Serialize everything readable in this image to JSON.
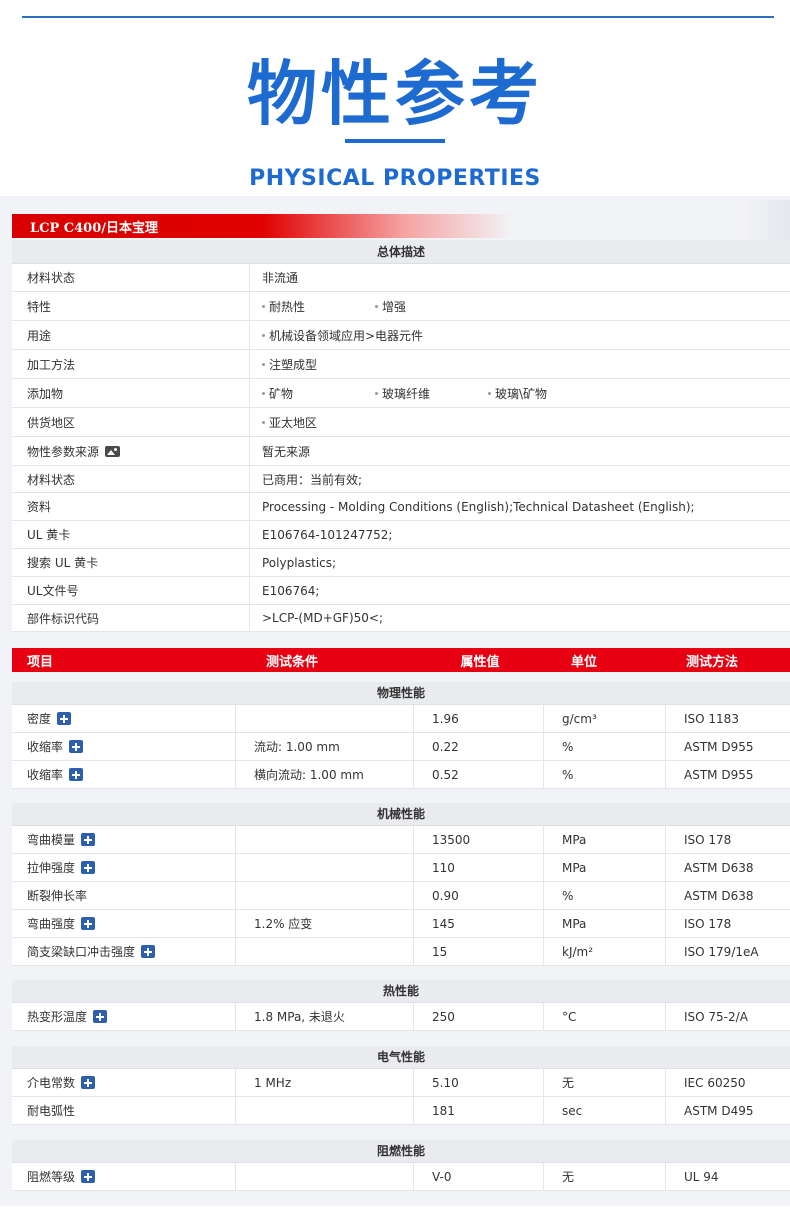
{
  "header": {
    "title": "物性参考",
    "subtitle": "PHYSICAL PROPERTIES"
  },
  "grade": {
    "title": "LCP C400/日本宝理"
  },
  "general": {
    "section_title": "总体描述",
    "rows": [
      {
        "label": "材料状态",
        "values": [
          "非流通"
        ],
        "bullets": false
      },
      {
        "label": "特性",
        "values": [
          "耐热性",
          "增强"
        ],
        "bullets": true
      },
      {
        "label": "用途",
        "values": [
          "机械设备领域应用>电器元件"
        ],
        "bullets": true
      },
      {
        "label": "加工方法",
        "values": [
          "注塑成型"
        ],
        "bullets": true
      },
      {
        "label": "添加物",
        "values": [
          "矿物",
          "玻璃纤维",
          "玻璃\\矿物"
        ],
        "bullets": true
      },
      {
        "label": "供货地区",
        "values": [
          "亚太地区"
        ],
        "bullets": true
      },
      {
        "label": "物性参数来源",
        "values": [
          "暂无来源"
        ],
        "bullets": false,
        "icon": "image-icon"
      },
      {
        "label": "材料状态",
        "values": [
          "已商用：当前有效;"
        ],
        "bullets": false
      },
      {
        "label": "资料",
        "values": [
          "Processing - Molding Conditions (English);Technical Datasheet (English);"
        ],
        "bullets": false
      },
      {
        "label": "UL 黄卡",
        "values": [
          "E106764-101247752;"
        ],
        "bullets": false
      },
      {
        "label": "搜索 UL 黄卡",
        "values": [
          "Polyplastics;"
        ],
        "bullets": false
      },
      {
        "label": "UL文件号",
        "values": [
          "E106764;"
        ],
        "bullets": false
      },
      {
        "label": "部件标识代码",
        "values": [
          ">LCP-(MD+GF)50<;"
        ],
        "bullets": false
      }
    ]
  },
  "table_header": {
    "item": "项目",
    "condition": "测试条件",
    "value": "属性值",
    "unit": "单位",
    "method": "测试方法"
  },
  "categories": [
    {
      "title": "物理性能",
      "rows": [
        {
          "name": "密度",
          "plus": true,
          "condition": "",
          "value": "1.96",
          "unit": "g/cm³",
          "method": "ISO 1183"
        },
        {
          "name": "收缩率",
          "plus": true,
          "condition": "流动: 1.00 mm",
          "value": "0.22",
          "unit": "%",
          "method": "ASTM D955"
        },
        {
          "name": "收缩率",
          "plus": true,
          "condition": "横向流动: 1.00 mm",
          "value": "0.52",
          "unit": "%",
          "method": "ASTM D955"
        }
      ]
    },
    {
      "title": "机械性能",
      "rows": [
        {
          "name": "弯曲模量",
          "plus": true,
          "condition": "",
          "value": "13500",
          "unit": "MPa",
          "method": "ISO 178"
        },
        {
          "name": "拉伸强度",
          "plus": true,
          "condition": "",
          "value": "110",
          "unit": "MPa",
          "method": "ASTM D638"
        },
        {
          "name": "断裂伸长率",
          "plus": false,
          "condition": "",
          "value": "0.90",
          "unit": "%",
          "method": "ASTM D638"
        },
        {
          "name": "弯曲强度",
          "plus": true,
          "condition": "1.2% 应变",
          "value": "145",
          "unit": "MPa",
          "method": "ISO 178"
        },
        {
          "name": "简支梁缺口冲击强度",
          "plus": true,
          "condition": "",
          "value": "15",
          "unit": "kJ/m²",
          "method": "ISO 179/1eA"
        }
      ]
    },
    {
      "title": "热性能",
      "rows": [
        {
          "name": "热变形温度",
          "plus": true,
          "condition": "1.8 MPa, 未退火",
          "value": "250",
          "unit": "°C",
          "method": "ISO 75-2/A"
        }
      ]
    },
    {
      "title": "电气性能",
      "rows": [
        {
          "name": "介电常数",
          "plus": true,
          "condition": "1 MHz",
          "value": "5.10",
          "unit": "无",
          "method": "IEC 60250"
        },
        {
          "name": "耐电弧性",
          "plus": false,
          "condition": "",
          "value": "181",
          "unit": "sec",
          "method": "ASTM D495"
        }
      ]
    },
    {
      "title": "阻燃性能",
      "rows": [
        {
          "name": "阻燃等级",
          "plus": true,
          "condition": "",
          "value": "V-0",
          "unit": "无",
          "method": "UL 94"
        }
      ]
    }
  ]
}
